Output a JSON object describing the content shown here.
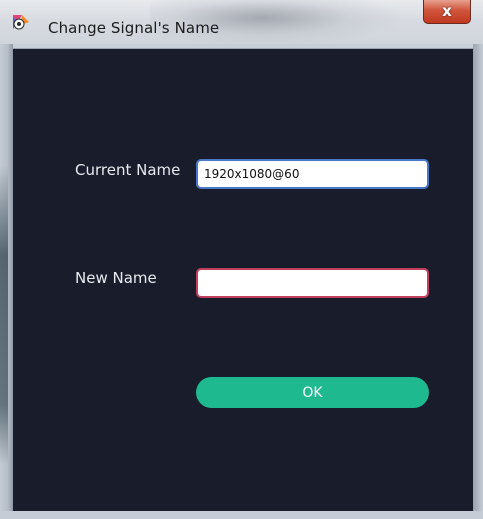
{
  "window": {
    "title": "Change Signal's Name",
    "close_glyph": "x",
    "icon": "app-logo-icon"
  },
  "form": {
    "current_name_label": "Current Name",
    "current_name_value": "1920x1080@60",
    "new_name_label": "New Name",
    "new_name_value": "",
    "ok_label": "OK"
  },
  "colors": {
    "background": "#181c2b",
    "ok_button": "#1fb98f",
    "current_input_border": "#4a79c9",
    "new_input_border": "#c2405f",
    "close_button": "#c9472c"
  }
}
